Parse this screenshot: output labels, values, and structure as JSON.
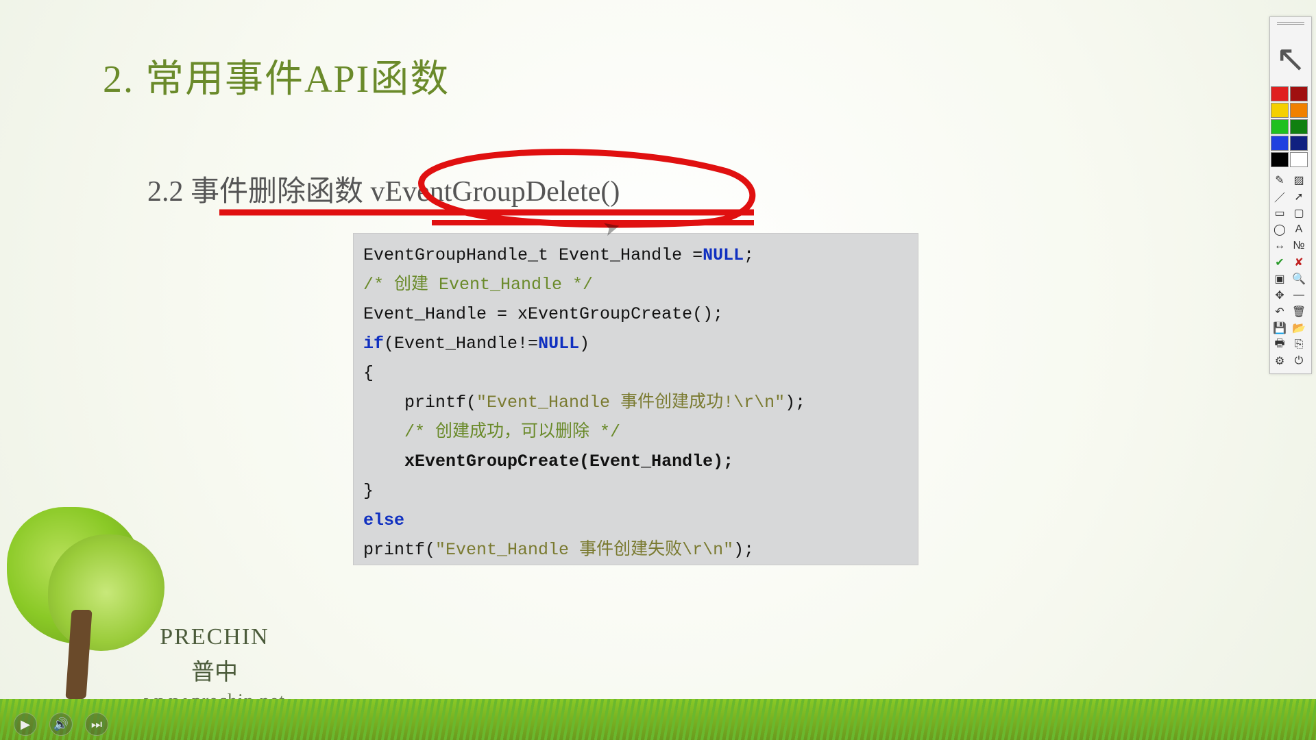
{
  "title": "2. 常用事件API函数",
  "subtitle": "2.2 事件删除函数 vEventGroupDelete()",
  "code": {
    "l1a": "EventGroupHandle_t Event_Handle =",
    "l1b": "NULL",
    "l1c": ";",
    "l2": "/* 创建 Event_Handle */",
    "l3": "Event_Handle = xEventGroupCreate();",
    "l4a": "if",
    "l4b": "(Event_Handle!=",
    "l4c": "NULL",
    "l4d": ")",
    "l5": "{",
    "l6a": "    printf(",
    "l6b": "\"Event_Handle 事件创建成功!\\r\\n\"",
    "l6c": ");",
    "l7": "    /* 创建成功，可以删除 */",
    "l8": "    xEventGroupCreate(Event_Handle);",
    "l9": "}",
    "l10": "else",
    "l11a": "printf(",
    "l11b": "\"Event_Handle 事件创建失败\\r\\n\"",
    "l11c": ");"
  },
  "brand": {
    "en": "PRECHIN",
    "cn": "普中",
    "url": "www.prechin.net"
  },
  "palette_tools": {
    "pen": "pen",
    "hl": "highlighter",
    "line": "line",
    "arrow": "arrow",
    "rect": "rect",
    "rrect": "rounded-rect",
    "ellipse": "ellipse",
    "text": "text",
    "hresize": "h-resize",
    "num": "number",
    "selrect": "select-rect",
    "zoom": "zoom",
    "move": "move",
    "minus": "minus",
    "undo": "undo",
    "del": "delete",
    "save": "save",
    "open": "open",
    "print": "print",
    "copy": "copy",
    "gear": "settings",
    "close": "close",
    "check": "confirm",
    "x": "cancel"
  }
}
